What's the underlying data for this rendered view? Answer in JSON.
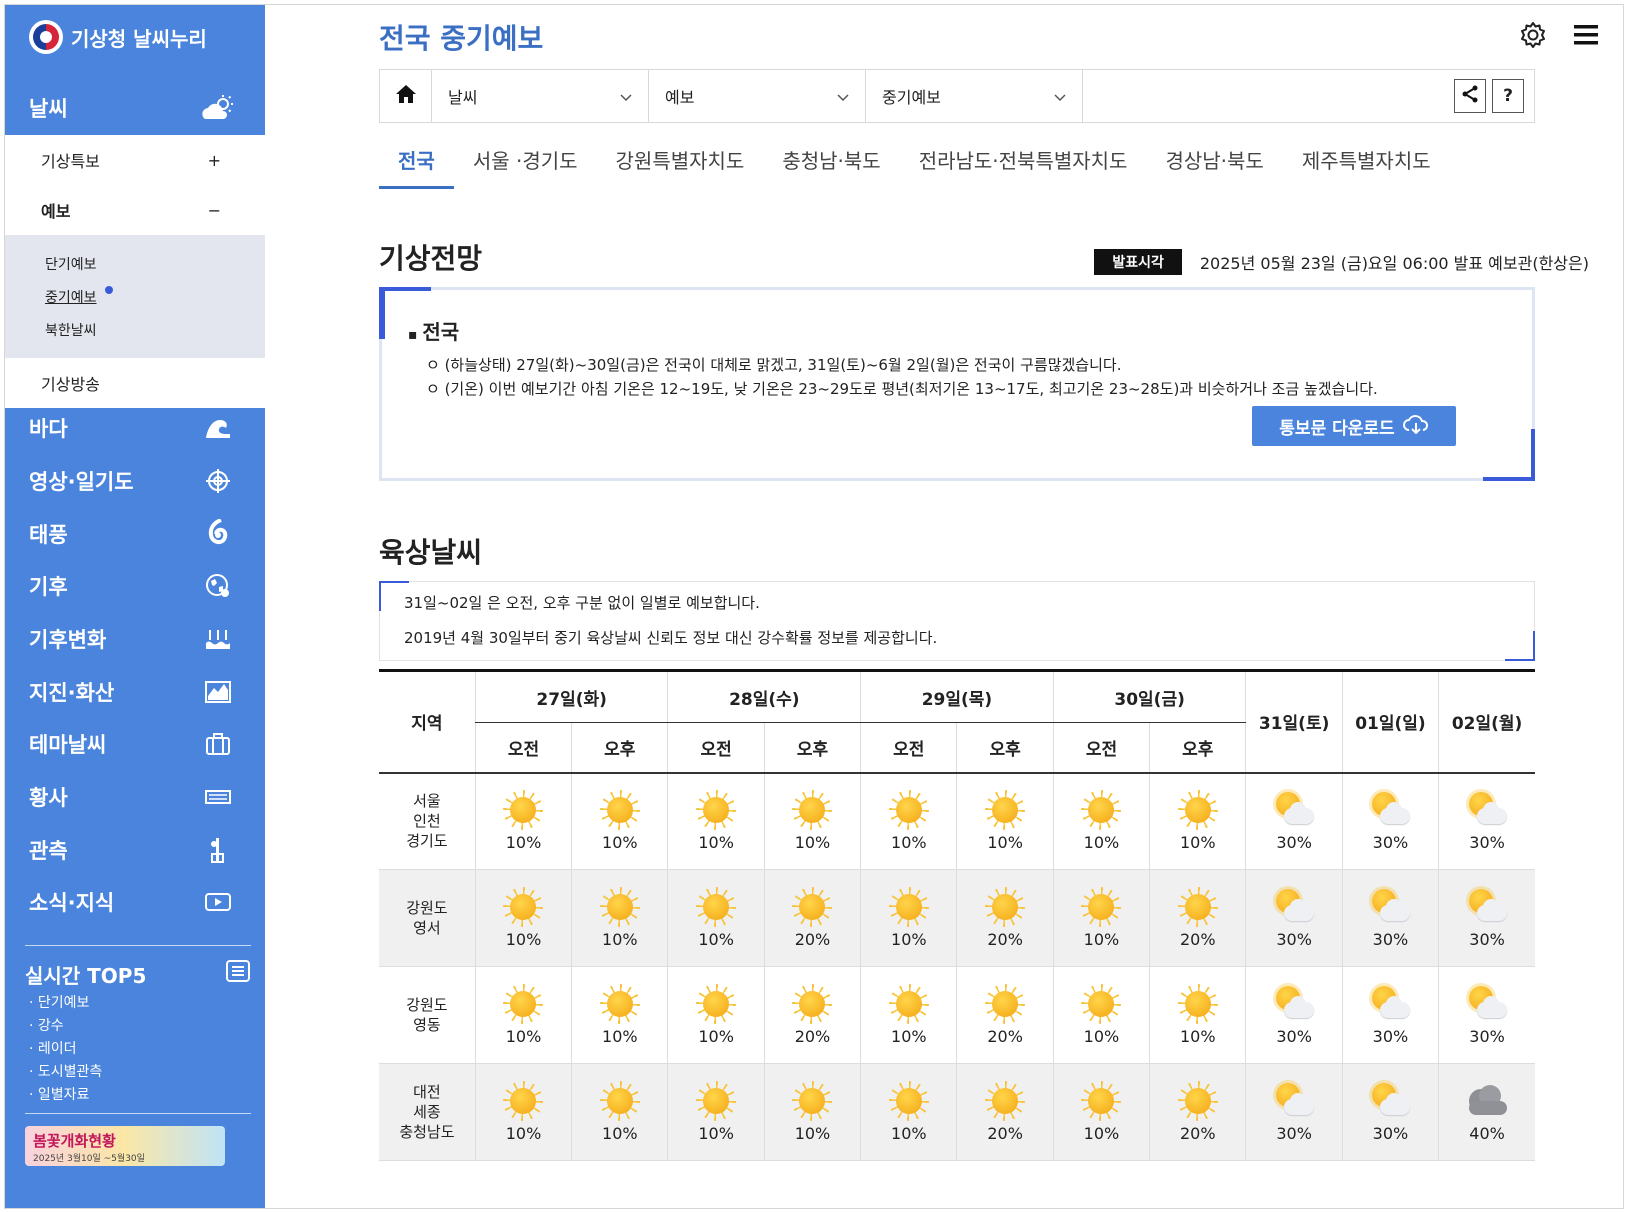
{
  "sidebar": {
    "logo": "기상청 날씨누리",
    "menu": [
      {
        "label": "날씨",
        "icon": "sun-cloud-icon"
      },
      {
        "label": "바다",
        "icon": "wave-icon"
      },
      {
        "label": "영상·일기도",
        "icon": "satellite-target-icon"
      },
      {
        "label": "태풍",
        "icon": "typhoon-icon"
      },
      {
        "label": "기후",
        "icon": "globe-icon"
      },
      {
        "label": "기후변화",
        "icon": "sea-level-icon"
      },
      {
        "label": "지진·화산",
        "icon": "earthquake-icon"
      },
      {
        "label": "테마날씨",
        "icon": "bag-icon"
      },
      {
        "label": "황사",
        "icon": "dust-icon"
      },
      {
        "label": "관측",
        "icon": "observation-icon"
      },
      {
        "label": "소식·지식",
        "icon": "video-icon"
      }
    ],
    "sub": {
      "special": "기상특보",
      "special_toggle": "+",
      "forecast": "예보",
      "forecast_toggle": "−",
      "leaves": [
        "단기예보",
        "중기예보",
        "북한날씨"
      ],
      "broadcast": "기상방송"
    },
    "top5": {
      "title": "실시간 TOP5",
      "items": [
        "· 단기예보",
        "· 강수",
        "· 레이더",
        "· 도시별관측",
        "· 일별자료"
      ]
    },
    "banner": {
      "title": "봄꽃개화현황",
      "sub": "2025년 3월10일 ~5월30일"
    }
  },
  "header": {
    "title": "전국 중기예보",
    "crumbs": [
      "날씨",
      "예보",
      "중기예보"
    ],
    "help_label": "?"
  },
  "tabs": [
    "전국",
    "서울 ·경기도",
    "강원특별자치도",
    "충청남·북도",
    "전라남도·전북특별자치도",
    "경상남·북도",
    "제주특별자치도"
  ],
  "outlook": {
    "title": "기상전망",
    "badge": "발표시각",
    "issued": "2025년 05월 23일 (금)요일 06:00 발표 예보관(한상은)",
    "region": "전국",
    "lines": [
      "ㅇ (하늘상태) 27일(화)~30일(금)은 전국이 대체로 맑겠고, 31일(토)~6월 2일(월)은 전국이 구름많겠습니다.",
      "ㅇ (기온) 이번 예보기간 아침 기온은 12~19도, 낮 기온은 23~29도로 평년(최저기온 13~17도, 최고기온 23~28도)과 비슷하거나 조금 높겠습니다."
    ],
    "download": "통보문 다운로드"
  },
  "land": {
    "title": "육상날씨",
    "notices": [
      "31일~02일 은 오전, 오후 구분 없이 일별로 예보합니다.",
      "2019년 4월 30일부터 중기 육상날씨 신뢰도 정보 대신 강수확률 정보를 제공합니다."
    ],
    "region_header": "지역",
    "split_days": [
      "27일(화)",
      "28일(수)",
      "29일(목)",
      "30일(금)"
    ],
    "am": "오전",
    "pm": "오후",
    "whole_days": [
      "31일(토)",
      "01일(일)",
      "02일(월)"
    ],
    "rows": [
      {
        "region": [
          "서울",
          "인천",
          "경기도"
        ],
        "cells": [
          [
            "sun",
            "10%"
          ],
          [
            "sun",
            "10%"
          ],
          [
            "sun",
            "10%"
          ],
          [
            "sun",
            "10%"
          ],
          [
            "sun",
            "10%"
          ],
          [
            "sun",
            "10%"
          ],
          [
            "sun",
            "10%"
          ],
          [
            "sun",
            "10%"
          ],
          [
            "pc",
            "30%"
          ],
          [
            "pc",
            "30%"
          ],
          [
            "pc",
            "30%"
          ]
        ]
      },
      {
        "region": [
          "강원도",
          "영서"
        ],
        "cells": [
          [
            "sun",
            "10%"
          ],
          [
            "sun",
            "10%"
          ],
          [
            "sun",
            "10%"
          ],
          [
            "sun",
            "20%"
          ],
          [
            "sun",
            "10%"
          ],
          [
            "sun",
            "20%"
          ],
          [
            "sun",
            "10%"
          ],
          [
            "sun",
            "20%"
          ],
          [
            "pc",
            "30%"
          ],
          [
            "pc",
            "30%"
          ],
          [
            "pc",
            "30%"
          ]
        ]
      },
      {
        "region": [
          "강원도",
          "영동"
        ],
        "cells": [
          [
            "sun",
            "10%"
          ],
          [
            "sun",
            "10%"
          ],
          [
            "sun",
            "10%"
          ],
          [
            "sun",
            "20%"
          ],
          [
            "sun",
            "10%"
          ],
          [
            "sun",
            "20%"
          ],
          [
            "sun",
            "10%"
          ],
          [
            "sun",
            "10%"
          ],
          [
            "pc",
            "30%"
          ],
          [
            "pc",
            "30%"
          ],
          [
            "pc",
            "30%"
          ]
        ]
      },
      {
        "region": [
          "대전",
          "세종",
          "충청남도"
        ],
        "cells": [
          [
            "sun",
            "10%"
          ],
          [
            "sun",
            "10%"
          ],
          [
            "sun",
            "10%"
          ],
          [
            "sun",
            "10%"
          ],
          [
            "sun",
            "10%"
          ],
          [
            "sun",
            "20%"
          ],
          [
            "sun",
            "10%"
          ],
          [
            "sun",
            "20%"
          ],
          [
            "pc",
            "30%"
          ],
          [
            "pc",
            "30%"
          ],
          [
            "cloud",
            "40%"
          ]
        ]
      }
    ]
  }
}
